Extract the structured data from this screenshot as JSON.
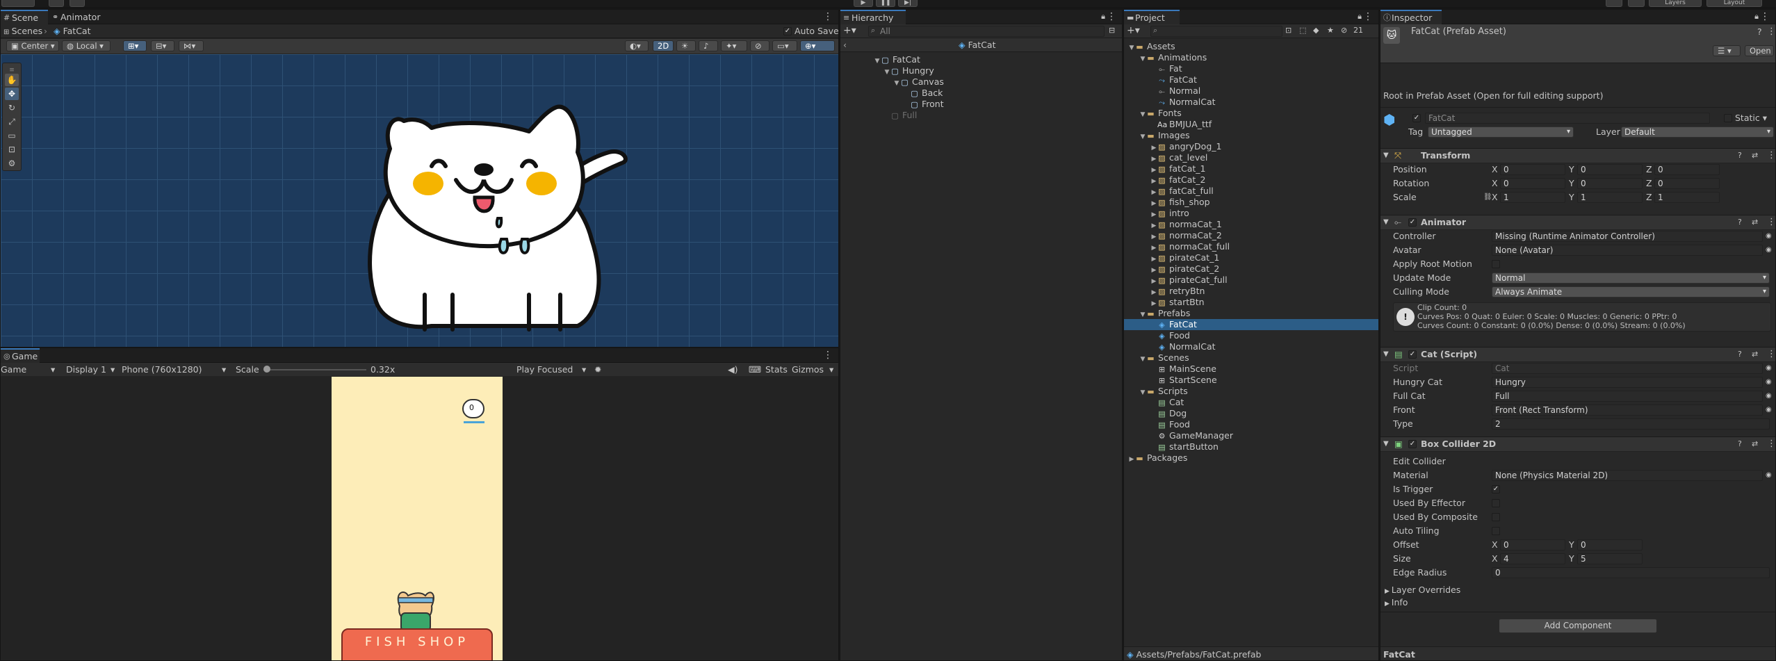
{
  "topbar": {
    "account": "",
    "cloud": "",
    "play": "▶",
    "pause": "❚❚",
    "step": "▶|",
    "layers": "Layers",
    "layout": "Layout"
  },
  "scene": {
    "tabs": [
      "Scene",
      "Animator"
    ],
    "breadcrumb_root": "Scenes",
    "breadcrumb_item": "FatCat",
    "auto_save": "Auto Save",
    "pivot": "Center",
    "space": "Local",
    "mode_2d": "2D",
    "prefab_title": "FatCat"
  },
  "game": {
    "tab": "Game",
    "mode": "Game",
    "display": "Display 1",
    "resolution": "Phone (760x1280)",
    "scale_label": "Scale",
    "scale_value": "0.32x",
    "play_mode": "Play Focused",
    "stats": "Stats",
    "gizmos": "Gizmos",
    "score": "0",
    "shop_text": "FISH SHOP"
  },
  "hierarchy": {
    "tab": "Hierarchy",
    "search_placeholder": "All",
    "prefab_name": "FatCat",
    "items": [
      {
        "label": "FatCat",
        "depth": 0,
        "expanded": true
      },
      {
        "label": "Hungry",
        "depth": 1,
        "expanded": true
      },
      {
        "label": "Canvas",
        "depth": 2,
        "expanded": true
      },
      {
        "label": "Back",
        "depth": 3
      },
      {
        "label": "Front",
        "depth": 3
      },
      {
        "label": "Full",
        "depth": 1,
        "disabled": true
      }
    ]
  },
  "project": {
    "tab": "Project",
    "count": "21",
    "path": "Assets/Prefabs/FatCat.prefab",
    "items": [
      {
        "label": "Assets",
        "depth": 0,
        "type": "folder",
        "expanded": true
      },
      {
        "label": "Animations",
        "depth": 1,
        "type": "folder",
        "expanded": true
      },
      {
        "label": "Fat",
        "depth": 2,
        "type": "controller"
      },
      {
        "label": "FatCat",
        "depth": 2,
        "type": "anim"
      },
      {
        "label": "Normal",
        "depth": 2,
        "type": "controller"
      },
      {
        "label": "NormalCat",
        "depth": 2,
        "type": "anim"
      },
      {
        "label": "Fonts",
        "depth": 1,
        "type": "folder",
        "expanded": true
      },
      {
        "label": "BMJUA_ttf",
        "depth": 2,
        "type": "font"
      },
      {
        "label": "Images",
        "depth": 1,
        "type": "folder",
        "expanded": true
      },
      {
        "label": "angryDog_1",
        "depth": 2,
        "type": "sprite"
      },
      {
        "label": "cat_level",
        "depth": 2,
        "type": "sprite"
      },
      {
        "label": "fatCat_1",
        "depth": 2,
        "type": "sprite"
      },
      {
        "label": "fatCat_2",
        "depth": 2,
        "type": "sprite"
      },
      {
        "label": "fatCat_full",
        "depth": 2,
        "type": "sprite"
      },
      {
        "label": "fish_shop",
        "depth": 2,
        "type": "sprite"
      },
      {
        "label": "intro",
        "depth": 2,
        "type": "sprite"
      },
      {
        "label": "normaCat_1",
        "depth": 2,
        "type": "sprite"
      },
      {
        "label": "normaCat_2",
        "depth": 2,
        "type": "sprite"
      },
      {
        "label": "normaCat_full",
        "depth": 2,
        "type": "sprite"
      },
      {
        "label": "pirateCat_1",
        "depth": 2,
        "type": "sprite"
      },
      {
        "label": "pirateCat_2",
        "depth": 2,
        "type": "sprite"
      },
      {
        "label": "pirateCat_full",
        "depth": 2,
        "type": "sprite"
      },
      {
        "label": "retryBtn",
        "depth": 2,
        "type": "sprite"
      },
      {
        "label": "startBtn",
        "depth": 2,
        "type": "sprite"
      },
      {
        "label": "Prefabs",
        "depth": 1,
        "type": "folder",
        "expanded": true
      },
      {
        "label": "FatCat",
        "depth": 2,
        "type": "prefab",
        "selected": true
      },
      {
        "label": "Food",
        "depth": 2,
        "type": "prefab"
      },
      {
        "label": "NormalCat",
        "depth": 2,
        "type": "prefab"
      },
      {
        "label": "Scenes",
        "depth": 1,
        "type": "folder",
        "expanded": true
      },
      {
        "label": "MainScene",
        "depth": 2,
        "type": "scene"
      },
      {
        "label": "StartScene",
        "depth": 2,
        "type": "scene"
      },
      {
        "label": "Scripts",
        "depth": 1,
        "type": "folder",
        "expanded": true
      },
      {
        "label": "Cat",
        "depth": 2,
        "type": "script"
      },
      {
        "label": "Dog",
        "depth": 2,
        "type": "script"
      },
      {
        "label": "Food",
        "depth": 2,
        "type": "script"
      },
      {
        "label": "GameManager",
        "depth": 2,
        "type": "gear"
      },
      {
        "label": "startButton",
        "depth": 2,
        "type": "script"
      },
      {
        "label": "Packages",
        "depth": 0,
        "type": "folder"
      }
    ]
  },
  "inspector": {
    "tab": "Inspector",
    "asset_title": "FatCat (Prefab Asset)",
    "open": "Open",
    "root_note": "Root in Prefab Asset (Open for full editing support)",
    "name": "FatCat",
    "static": "Static",
    "tag_label": "Tag",
    "tag_value": "Untagged",
    "layer_label": "Layer",
    "layer_value": "Default",
    "transform": {
      "title": "Transform",
      "rows": [
        {
          "label": "Position",
          "x": "0",
          "y": "0",
          "z": "0"
        },
        {
          "label": "Rotation",
          "x": "0",
          "y": "0",
          "z": "0"
        },
        {
          "label": "Scale",
          "x": "1",
          "y": "1",
          "z": "1"
        }
      ]
    },
    "animator": {
      "title": "Animator",
      "rows": [
        {
          "label": "Controller",
          "value": "Missing (Runtime Animator Controller)"
        },
        {
          "label": "Avatar",
          "value": "None (Avatar)"
        },
        {
          "label": "Apply Root Motion",
          "value": ""
        },
        {
          "label": "Update Mode",
          "value": "Normal"
        },
        {
          "label": "Culling Mode",
          "value": "Always Animate"
        }
      ],
      "info": [
        "Clip Count: 0",
        "Curves Pos: 0 Quat: 0 Euler: 0 Scale: 0 Muscles: 0 Generic: 0 PPtr: 0",
        "Curves Count: 0 Constant: 0 (0.0%) Dense: 0 (0.0%) Stream: 0 (0.0%)"
      ]
    },
    "cat_script": {
      "title": "Cat (Script)",
      "rows": [
        {
          "label": "Script",
          "value": "Cat"
        },
        {
          "label": "Hungry Cat",
          "value": "Hungry"
        },
        {
          "label": "Full Cat",
          "value": "Full"
        },
        {
          "label": "Front",
          "value": "Front (Rect Transform)"
        },
        {
          "label": "Type",
          "value": "2"
        }
      ]
    },
    "box_collider": {
      "title": "Box Collider 2D",
      "edit": "Edit Collider",
      "rows": [
        {
          "label": "Material",
          "value": "None (Physics Material 2D)"
        },
        {
          "label": "Is Trigger",
          "value": "✓"
        },
        {
          "label": "Used By Effector",
          "value": ""
        },
        {
          "label": "Used By Composite",
          "value": ""
        },
        {
          "label": "Auto Tiling",
          "value": ""
        }
      ],
      "offset": {
        "label": "Offset",
        "x": "0",
        "y": "0"
      },
      "size": {
        "label": "Size",
        "x": "4",
        "y": "5"
      },
      "edge": {
        "label": "Edge Radius",
        "value": "0"
      }
    },
    "layer_overrides": "Layer Overrides",
    "info": "Info",
    "add_component": "Add Component",
    "footer": "FatCat"
  }
}
